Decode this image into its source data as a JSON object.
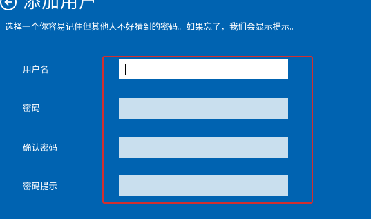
{
  "header": {
    "back_icon": "back-arrow-circle-icon",
    "title": "添加用户"
  },
  "description": "选择一个你容易记住但其他人不好猜到的密码。如果忘了，我们会显示提示。",
  "form": {
    "username": {
      "label": "用户名",
      "value": "",
      "placeholder": ""
    },
    "password": {
      "label": "密码",
      "value": "",
      "placeholder": ""
    },
    "confirm_password": {
      "label": "确认密码",
      "value": "",
      "placeholder": ""
    },
    "password_hint": {
      "label": "密码提示",
      "value": "",
      "placeholder": ""
    }
  },
  "colors": {
    "background": "#0063b1",
    "active_input": "#ffffff",
    "inactive_input": "#c9dfee",
    "highlight_border": "#d32f2f"
  }
}
